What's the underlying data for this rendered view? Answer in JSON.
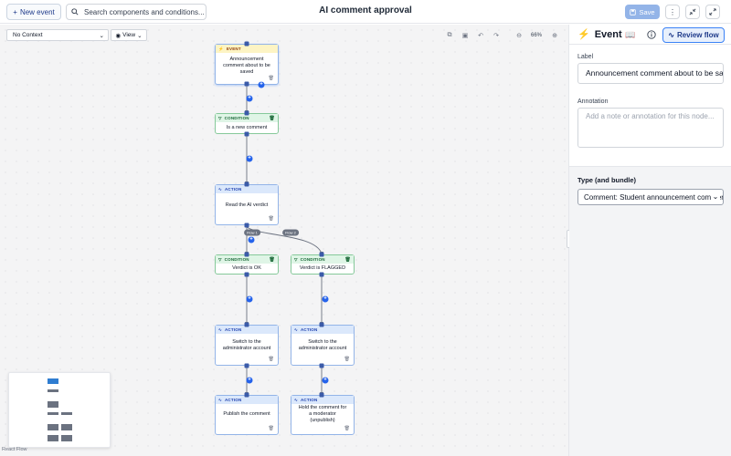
{
  "header": {
    "new_event_label": "New event",
    "search_placeholder": "Search components and conditions...",
    "title": "AI comment approval",
    "save_label": "Save",
    "more_icon": "ellipsis-vertical-icon",
    "collapse_icon": "collapse-arrows-icon",
    "expand_icon": "expand-arrows-icon"
  },
  "canvas": {
    "context_select": "No Context",
    "view_label": "View",
    "zoom": "66%",
    "attribution": "React Flow",
    "nodes": {
      "event": {
        "type": "EVENT",
        "text": "Announcement comment about to be saved"
      },
      "cond_new": {
        "type": "CONDITION",
        "text": "Is a new comment"
      },
      "action_read": {
        "type": "ACTION",
        "text": "Read the AI verdict"
      },
      "cond_ok": {
        "type": "CONDITION",
        "text": "Verdict is OK"
      },
      "cond_flagged": {
        "type": "CONDITION",
        "text": "Verdict is FLAGGED"
      },
      "action_admin1": {
        "type": "ACTION",
        "text": "Switch to the administrator account"
      },
      "action_admin2": {
        "type": "ACTION",
        "text": "Switch to the administrator account"
      },
      "action_publish": {
        "type": "ACTION",
        "text": "Publish the comment"
      },
      "action_hold": {
        "type": "ACTION",
        "text": "Hold the comment for a moderator (unpublish)"
      }
    },
    "flow_labels": {
      "flow1": "Flow 1",
      "flow2": "Flow 2"
    }
  },
  "panel": {
    "title": "Event",
    "review_label": "Review flow",
    "label_field_label": "Label",
    "label_value": "Announcement comment about to be saved",
    "annotation_label": "Annotation",
    "annotation_placeholder": "Add a note or annotation for this node...",
    "type_label": "Type (and bundle)",
    "type_value": "Comment: Student announcement comment"
  },
  "colors": {
    "accent": "#2563eb",
    "condition": "#86c99a",
    "action": "#93b4e8",
    "event_header": "#fdf4c4"
  }
}
